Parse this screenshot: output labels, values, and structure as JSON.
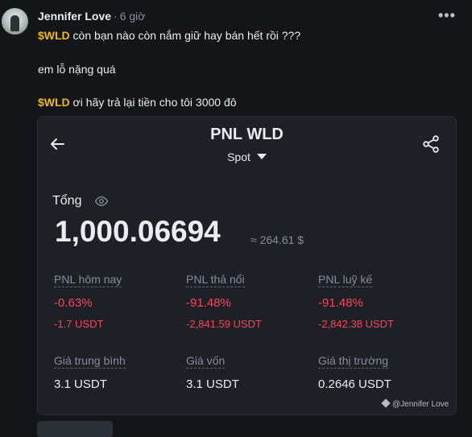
{
  "post": {
    "author": "Jennifer Love",
    "time": "6 giờ",
    "line1_tag": "$WLD",
    "line1_text": " còn bạn nào còn nắm giữ hay bán hết rồi ???",
    "line2": "em lỗ nặng quá",
    "line3_tag": "$WLD",
    "line3_text": " ơi hãy trả lại tiền cho tôi 3000 đô"
  },
  "card": {
    "title": "PNL WLD",
    "mode": "Spot",
    "total_label": "Tổng",
    "total_value": "1,000.06694",
    "total_approx": "≈ 264.61 $",
    "stats": {
      "today_label": "PNL hôm nay",
      "today_pct": "-0.63%",
      "today_usdt": "-1.7 USDT",
      "floating_label": "PNL thả nổi",
      "floating_pct": "-91.48%",
      "floating_usdt": "-2,841.59 USDT",
      "cumulative_label": "PNL luỹ kế",
      "cumulative_pct": "-91.48%",
      "cumulative_usdt": "-2,842.38 USDT",
      "avg_label": "Giá trung bình",
      "avg_value": "3.1 USDT",
      "cost_label": "Giá vốn",
      "cost_value": "3.1 USDT",
      "market_label": "Giá thị trường",
      "market_value": "0.2646 USDT"
    },
    "watermark": "@Jennifer Love"
  },
  "colors": {
    "accent": "#f0b90b",
    "negative": "#f6465d",
    "muted": "#848e9c"
  },
  "icons": [
    "back-arrow-icon",
    "share-icon",
    "eye-icon",
    "more-icon",
    "caret-down-icon"
  ]
}
